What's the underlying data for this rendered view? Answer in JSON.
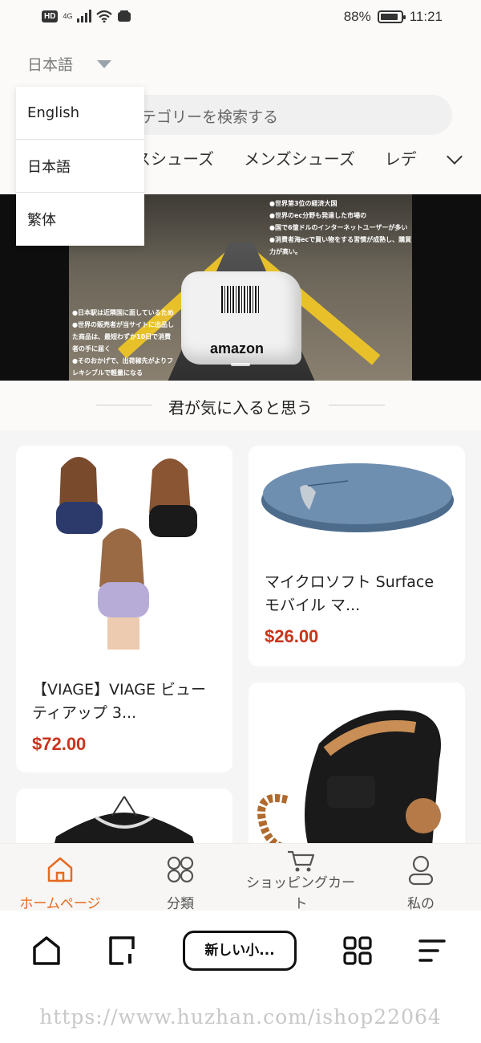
{
  "status_bar": {
    "network_badge": "HD",
    "network_type": "4G",
    "battery": "88%",
    "time": "11:21"
  },
  "header": {
    "language_current": "日本語",
    "search_placeholder": "テゴリーを検索する",
    "category_tabs": [
      "スシューズ",
      "メンズシューズ",
      "レデ"
    ]
  },
  "language_menu": {
    "options": [
      "English",
      "日本語",
      "繁体"
    ]
  },
  "banner": {
    "brand": "amazon",
    "text_top": "●世界第3位の経済大国\n●世界のec分野も発達した市場の\n●国で6億ドルのインターネットユーザーが多い\n●消費者海ecで買い物をする習慣が成熟し、購買力が高い。",
    "text_bottom": "●日本駅は近隣国に面しているため\n●世界の販売者が当サイトに出品した商品は、最短わずか10日で消費者の手に届く\n●そのおかげで、出荷稼先がよりフレキシブルで軽量になる"
  },
  "section": {
    "title": "君が気に入ると思う"
  },
  "products": [
    {
      "title": "【VIAGE】VIAGE ビューティアップ 3...",
      "price": "$72.00"
    },
    {
      "title": "マイクロソフト Surface モバイル マ...",
      "price": "$26.00"
    },
    {
      "title": "",
      "price": ""
    },
    {
      "title": "",
      "price": ""
    }
  ],
  "app_nav": [
    {
      "label": "ホームページ",
      "icon": "home-icon",
      "active": true
    },
    {
      "label": "分類",
      "icon": "grid-icon",
      "active": false
    },
    {
      "label": "ショッピングカート",
      "icon": "cart-icon",
      "active": false
    },
    {
      "label": "私の",
      "icon": "person-icon",
      "active": false
    }
  ],
  "system_bar": {
    "tab_label": "新しい小...",
    "watermark": "https://www.huzhan.com/ishop22064"
  },
  "colors": {
    "accent": "#e66a1f",
    "price": "#c9341c",
    "background": "#f5f5f5"
  }
}
